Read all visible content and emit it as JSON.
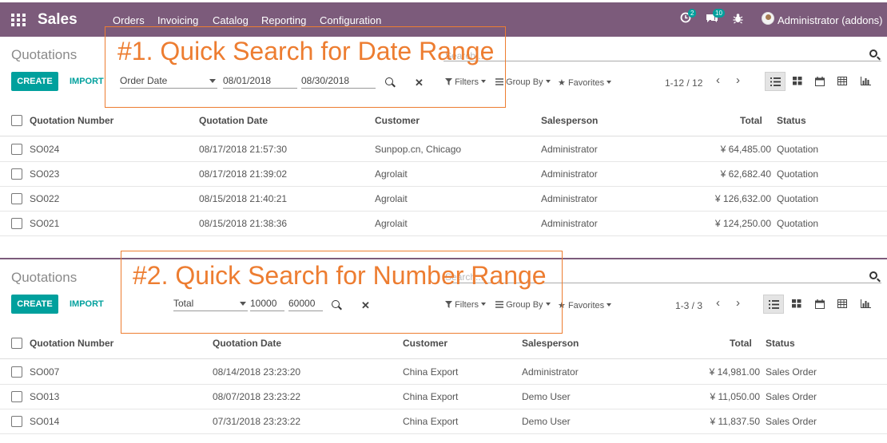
{
  "navbar": {
    "brand": "Sales",
    "menu": [
      "Orders",
      "Invoicing",
      "Catalog",
      "Reporting",
      "Configuration"
    ],
    "activity_count": "2",
    "messages_count": "10",
    "user": "Administrator (addons)",
    "color": "#7c5b7b"
  },
  "panel1": {
    "title": "Quotations",
    "search_placeholder": "Search...",
    "create_label": "CREATE",
    "import_label": "IMPORT",
    "range_field": "Order Date",
    "range_from": "08/01/2018",
    "range_to": "08/30/2018",
    "filters_label": "Filters",
    "groupby_label": "Group By",
    "favorites_label": "Favorites",
    "pager": "1-12 / 12",
    "annotation": "#1. Quick Search for Date Range",
    "columns": [
      "Quotation Number",
      "Quotation Date",
      "Customer",
      "Salesperson",
      "Total",
      "Status"
    ],
    "rows": [
      {
        "number": "SO024",
        "date": "08/17/2018 21:57:30",
        "customer": "Sunpop.cn, Chicago",
        "salesperson": "Administrator",
        "total": "¥ 64,485.00",
        "status": "Quotation"
      },
      {
        "number": "SO023",
        "date": "08/17/2018 21:39:02",
        "customer": "Agrolait",
        "salesperson": "Administrator",
        "total": "¥ 62,682.40",
        "status": "Quotation"
      },
      {
        "number": "SO022",
        "date": "08/15/2018 21:40:21",
        "customer": "Agrolait",
        "salesperson": "Administrator",
        "total": "¥ 126,632.00",
        "status": "Quotation"
      },
      {
        "number": "SO021",
        "date": "08/15/2018 21:38:36",
        "customer": "Agrolait",
        "salesperson": "Administrator",
        "total": "¥ 124,250.00",
        "status": "Quotation"
      }
    ]
  },
  "panel2": {
    "title": "Quotations",
    "search_placeholder": "Search...",
    "create_label": "CREATE",
    "import_label": "IMPORT",
    "range_field": "Total",
    "range_from": "10000",
    "range_to": "60000",
    "filters_label": "Filters",
    "groupby_label": "Group By",
    "favorites_label": "Favorites",
    "pager": "1-3 / 3",
    "annotation": "#2. Quick Search for Number Range",
    "columns": [
      "Quotation Number",
      "Quotation Date",
      "Customer",
      "Salesperson",
      "Total",
      "Status"
    ],
    "rows": [
      {
        "number": "SO007",
        "date": "08/14/2018 23:23:20",
        "customer": "China Export",
        "salesperson": "Administrator",
        "total": "¥ 14,981.00",
        "status": "Sales Order"
      },
      {
        "number": "SO013",
        "date": "08/07/2018 23:23:22",
        "customer": "China Export",
        "salesperson": "Demo User",
        "total": "¥ 11,050.00",
        "status": "Sales Order"
      },
      {
        "number": "SO014",
        "date": "07/31/2018 23:23:22",
        "customer": "China Export",
        "salesperson": "Demo User",
        "total": "¥ 11,837.50",
        "status": "Sales Order"
      }
    ]
  },
  "colors": {
    "accent": "#00a09d",
    "annotation": "#ed7d31"
  }
}
